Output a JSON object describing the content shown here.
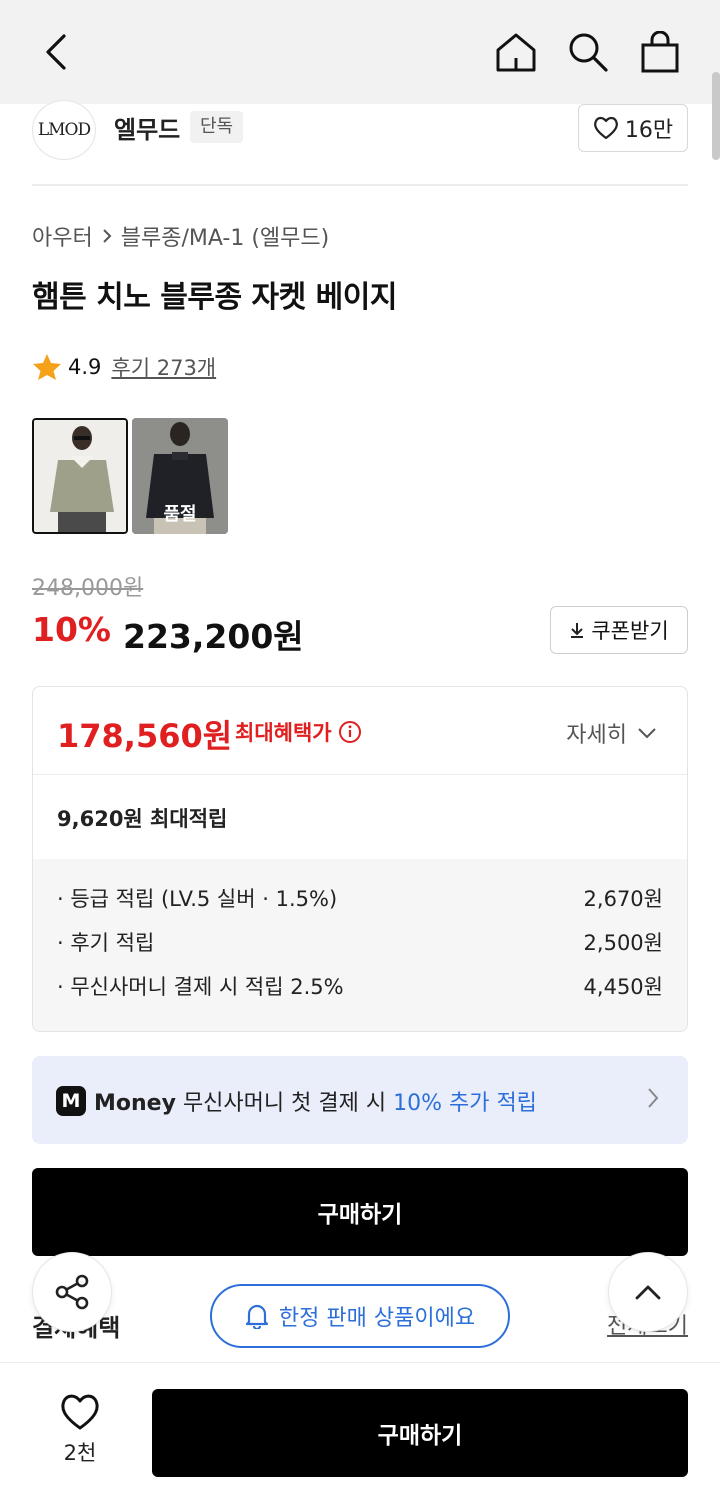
{
  "header": {
    "icons": [
      "back-icon",
      "home-icon",
      "search-icon",
      "bag-icon"
    ]
  },
  "brand": {
    "logo_text": "LMOD",
    "name": "엘무드",
    "badge": "단독",
    "likes": "16만"
  },
  "product": {
    "breadcrumb": [
      "아우터",
      "블루종/MA-1 (엘무드)"
    ],
    "title": "햄튼 치노 블루종 자켓 베이지",
    "rating": "4.9",
    "reviews_link": "후기 273개",
    "thumbnails": [
      {
        "label": ""
      },
      {
        "label": "품절"
      }
    ],
    "original_price": "248,000원",
    "discount_rate": "10%",
    "sale_price": "223,200원",
    "coupon_label": "쿠폰받기"
  },
  "benefits": {
    "max_price": "178,560원",
    "max_label": "최대혜택가",
    "detail_label": "자세히",
    "points_total": "9,620원 최대적립",
    "points": [
      {
        "label": "· 등급 적립 (LV.5 실버 · 1.5%)",
        "value": "2,670원"
      },
      {
        "label": "· 후기 적립",
        "value": "2,500원"
      },
      {
        "label": "· 무신사머니 결제 시 적립 2.5%",
        "value": "4,450원"
      }
    ]
  },
  "money_banner": {
    "logo": "M",
    "brand": "Money",
    "text": "무신사머니 첫 결제 시",
    "highlight": "10% 추가 적립"
  },
  "buy_inline_label": "구매하기",
  "payment_section": {
    "title": "결제혜택",
    "see_all": "전체보기"
  },
  "limited_pill": "한정 판매 상품이에요",
  "bottom_bar": {
    "wish_count": "2천",
    "buy_label": "구매하기"
  },
  "colors": {
    "accent_red": "#e02020",
    "accent_blue": "#2d6fd8",
    "black": "#000000"
  }
}
